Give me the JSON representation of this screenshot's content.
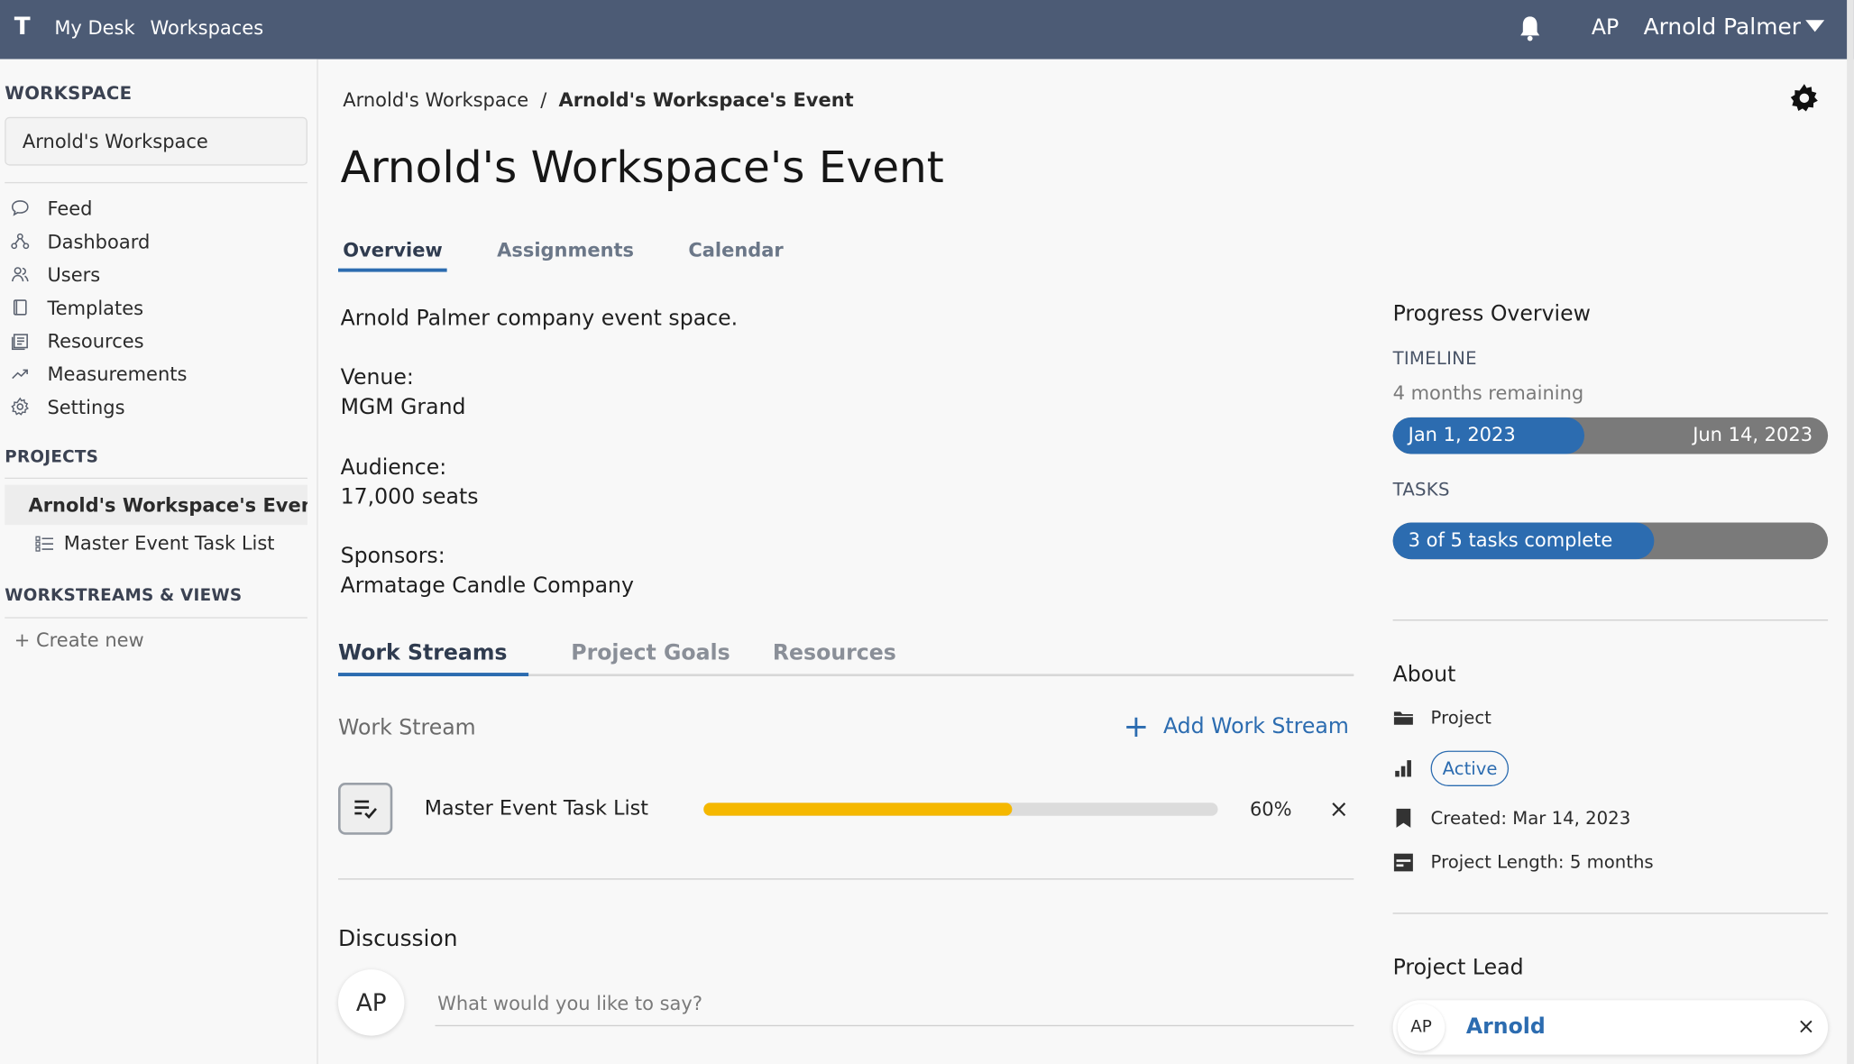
{
  "topbar": {
    "logo": "T",
    "nav": [
      "My Desk",
      "Workspaces"
    ],
    "user_initials": "AP",
    "user_name": "Arnold Palmer"
  },
  "sidebar": {
    "workspace_heading": "WORKSPACE",
    "workspace_name": "Arnold's Workspace",
    "items": [
      {
        "label": "Feed",
        "icon": "chat-bubble-icon"
      },
      {
        "label": "Dashboard",
        "icon": "network-icon"
      },
      {
        "label": "Users",
        "icon": "users-icon"
      },
      {
        "label": "Templates",
        "icon": "template-icon"
      },
      {
        "label": "Resources",
        "icon": "resources-icon"
      },
      {
        "label": "Measurements",
        "icon": "trend-icon"
      },
      {
        "label": "Settings",
        "icon": "gear-icon"
      }
    ],
    "projects_heading": "PROJECTS",
    "project_active": "Arnold's Workspace's Event",
    "project_sub": "Master Event Task List",
    "workstreams_heading": "WORKSTREAMS & VIEWS",
    "create_new": "+ Create new"
  },
  "main": {
    "breadcrumb": {
      "parent": "Arnold's Workspace",
      "separator": "/",
      "current": "Arnold's Workspace's Event"
    },
    "title": "Arnold's Workspace's Event",
    "tabs": [
      "Overview",
      "Assignments",
      "Calendar"
    ],
    "description": {
      "intro": "Arnold Palmer company event space.",
      "venue_label": "Venue:",
      "venue": "MGM Grand",
      "audience_label": "Audience:",
      "audience": "17,000 seats",
      "sponsors_label": "Sponsors:",
      "sponsors": "Armatage Candle Company"
    },
    "section_tabs": [
      "Work Streams",
      "Project Goals",
      "Resources"
    ],
    "workstream_header": "Work Stream",
    "add_workstream": "Add Work Stream",
    "workstream": {
      "name": "Master Event Task List",
      "progress": 0.6,
      "percent_label": "60%",
      "remove": "×"
    },
    "discussion": {
      "title": "Discussion",
      "avatar": "AP",
      "placeholder": "What would you like to say?"
    }
  },
  "right": {
    "progress_title": "Progress Overview",
    "timeline_label": "TIMELINE",
    "timeline_sub": "4 months remaining",
    "timeline_start": "Jan 1, 2023",
    "timeline_end": "Jun 14, 2023",
    "timeline_progress": 0.44,
    "tasks_label": "TASKS",
    "tasks_text": "3 of 5 tasks complete",
    "tasks_progress": 0.6,
    "about_title": "About",
    "about_type": "Project",
    "about_status": "Active",
    "about_created": "Created: Mar 14, 2023",
    "about_length": "Project Length: 5 months",
    "lead_title": "Project Lead",
    "lead_initials": "AP",
    "lead_name": "Arnold",
    "lead_remove": "×"
  },
  "colors": {
    "topbar": "#4c5b75",
    "accent": "#2c6cb0",
    "progress": "#f5b800"
  }
}
